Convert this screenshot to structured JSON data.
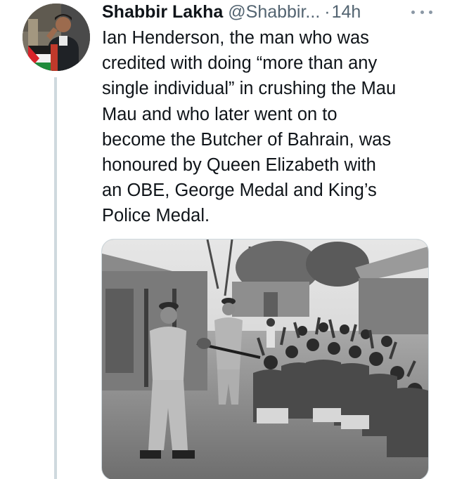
{
  "author": {
    "name": "Shabbir Lakha",
    "handle": "@Shabbir...",
    "separator": "·",
    "time": "14h"
  },
  "tweet": {
    "text": "Ian Henderson, the man who was\ncredited with doing “more than any\nsingle individual” in crushing the Mau\nMau and who later went on to\nbecome the Butcher of Bahrain, was\nhonoured by Queen Elizabeth with\nan OBE, George Medal and King’s\nPolice Medal."
  },
  "icons": {
    "more": "more-options-icon",
    "avatar": "avatar"
  },
  "colors": {
    "text": "#0f1419",
    "secondary": "#536471",
    "thread_line": "#cfd9de"
  },
  "media": {
    "type": "black-and-white historical photograph"
  }
}
